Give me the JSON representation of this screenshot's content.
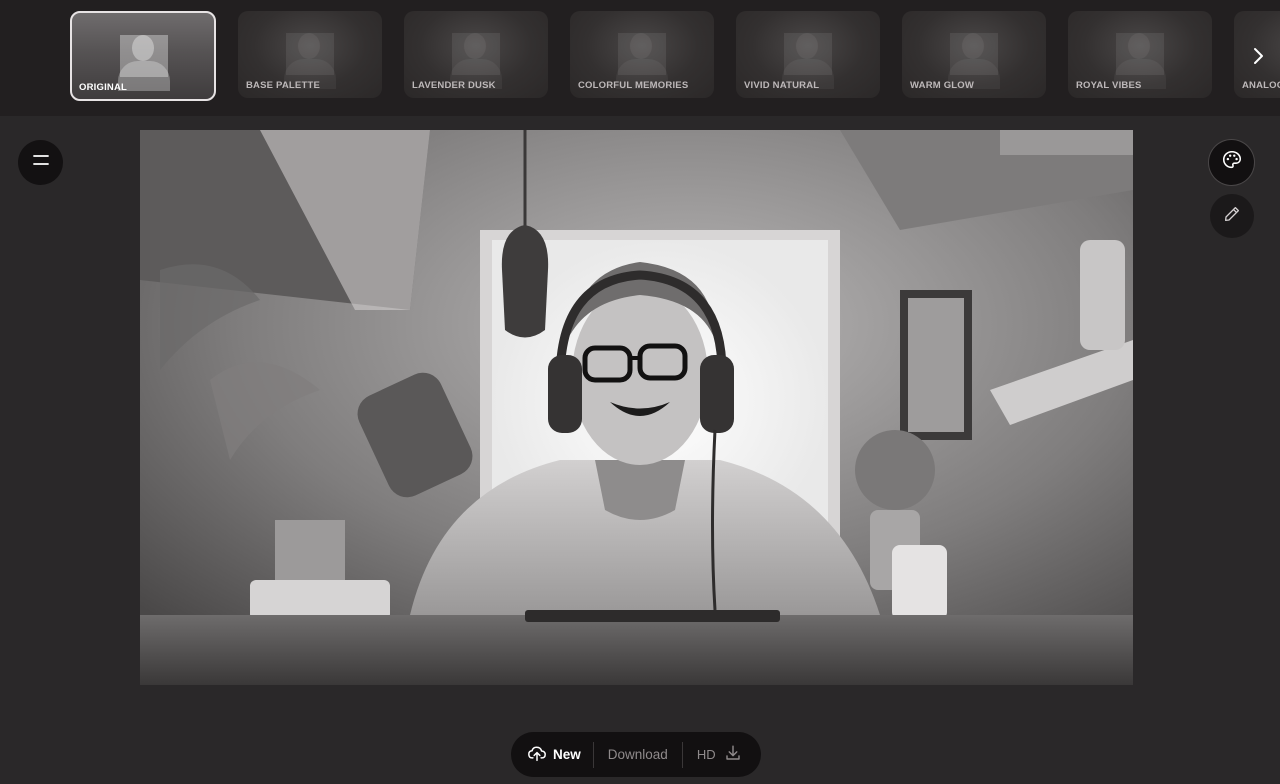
{
  "filters": [
    {
      "label": "ORIGINAL",
      "selected": true
    },
    {
      "label": "BASE PALETTE",
      "selected": false
    },
    {
      "label": "LAVENDER DUSK",
      "selected": false
    },
    {
      "label": "COLORFUL MEMORIES",
      "selected": false
    },
    {
      "label": "VIVID NATURAL",
      "selected": false
    },
    {
      "label": "WARM GLOW",
      "selected": false
    },
    {
      "label": "ROYAL VIBES",
      "selected": false
    },
    {
      "label": "ANALOG",
      "selected": false
    }
  ],
  "icons": {
    "next": "chevron-right-icon",
    "menu": "menu-icon",
    "palette": "palette-icon",
    "edit": "pencil-icon",
    "upload": "cloud-upload-icon",
    "hd_download": "download-icon"
  },
  "bottom_bar": {
    "new_label": "New",
    "download_label": "Download",
    "hd_label": "HD"
  },
  "colors": {
    "background": "#2a2829",
    "top_strip": "#221f20",
    "button_dark": "#131112"
  }
}
